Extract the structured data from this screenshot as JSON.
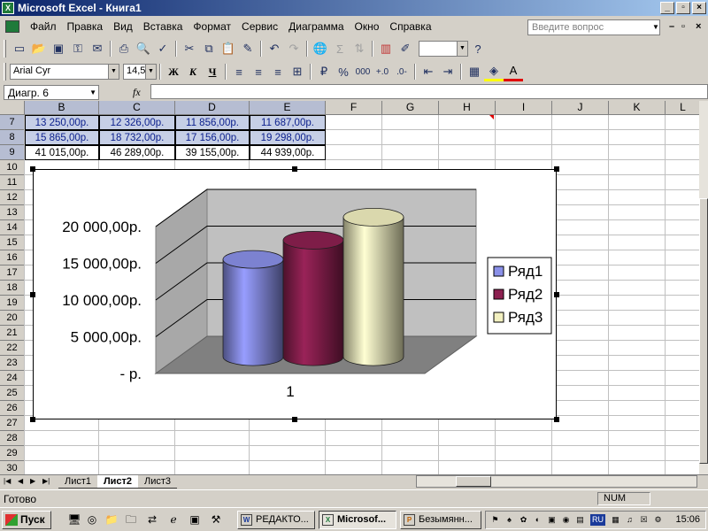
{
  "window": {
    "title": "Microsoft Excel - Книга1",
    "app_icon": "excel-icon"
  },
  "menu": {
    "items": [
      "Файл",
      "Правка",
      "Вид",
      "Вставка",
      "Формат",
      "Сервис",
      "Диаграмма",
      "Окно",
      "Справка"
    ],
    "help_placeholder": "Введите вопрос"
  },
  "toolbar_standard": {
    "icons": [
      "new-icon",
      "open-icon",
      "save-icon",
      "permission-icon",
      "email-icon",
      "print-icon",
      "print-preview-icon",
      "spelling-icon",
      "cut-icon",
      "copy-icon",
      "paste-icon",
      "format-painter-icon",
      "undo-icon",
      "redo-icon",
      "hyperlink-icon",
      "autosum-icon",
      "sort-icon",
      "chart-wizard-icon",
      "drawing-icon",
      "zoom-combo",
      "help-icon"
    ]
  },
  "toolbar_format": {
    "font": "Arial Cyr",
    "size": "14,5",
    "bold": "Ж",
    "italic": "К",
    "underline": "Ч",
    "percent": "%",
    "thousands": "000"
  },
  "formula_bar": {
    "name_box": "Диагр. 6",
    "fx": "fx",
    "value": ""
  },
  "grid": {
    "columns": [
      "B",
      "C",
      "D",
      "E",
      "F",
      "G",
      "H",
      "I",
      "J",
      "K",
      "L"
    ],
    "rows": [
      "7",
      "8",
      "9",
      "10",
      "11",
      "12",
      "13",
      "14",
      "15",
      "16",
      "17",
      "18",
      "19",
      "20",
      "21",
      "22",
      "23",
      "24",
      "25",
      "26",
      "27",
      "28",
      "29",
      "30"
    ],
    "data": [
      [
        "13 250,00р.",
        "12 326,00р.",
        "11 856,00р.",
        "11 687,00р."
      ],
      [
        "15 865,00р.",
        "18 732,00р.",
        "17 156,00р.",
        "19 298,00р."
      ],
      [
        "41 015,00р.",
        "46 289,00р.",
        "39 155,00р.",
        "44 939,00р."
      ]
    ]
  },
  "chart_data": {
    "type": "bar",
    "style": "3d-cylinder",
    "categories": [
      "1"
    ],
    "series": [
      {
        "name": "Ряд1",
        "values": [
          13250
        ],
        "color": "#8a90e8"
      },
      {
        "name": "Ряд2",
        "values": [
          15865
        ],
        "color": "#8c2050"
      },
      {
        "name": "Ряд3",
        "values": [
          19000
        ],
        "color": "#f2f0c0"
      }
    ],
    "yticks": [
      "-   р.",
      "5 000,00р.",
      "10 000,00р.",
      "15 000,00р.",
      "20 000,00р."
    ],
    "ylim": [
      0,
      20000
    ],
    "grid": true,
    "legend": "right"
  },
  "sheets": {
    "tabs": [
      "Лист1",
      "Лист2",
      "Лист3"
    ],
    "active": "Лист2"
  },
  "status": {
    "ready": "Готово",
    "num": "NUM"
  },
  "taskbar": {
    "start": "Пуск",
    "buttons": [
      "РЕДАКТО...",
      "Microsof...",
      "Безымянн..."
    ],
    "active_button": "Microsof...",
    "clock": "15:06",
    "lang": "RU"
  }
}
